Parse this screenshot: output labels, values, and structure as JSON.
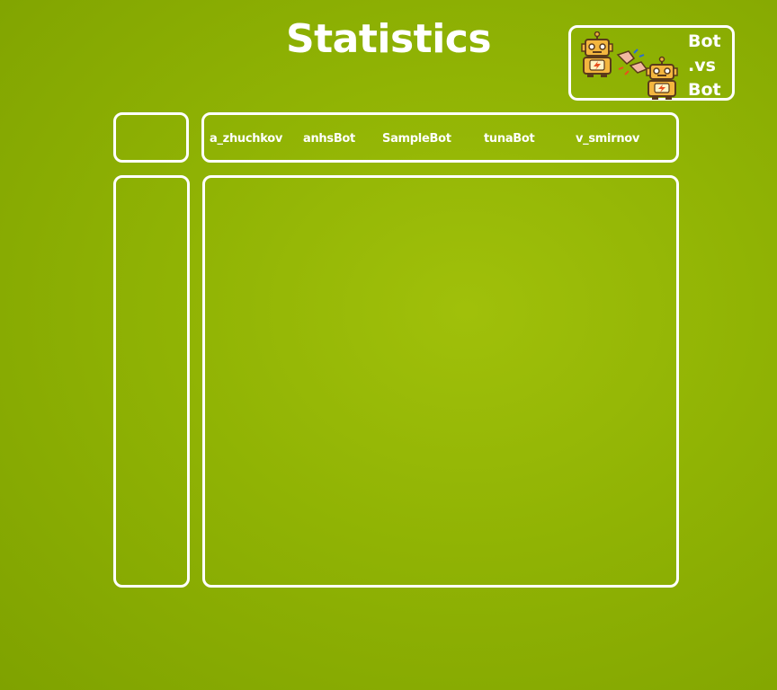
{
  "page": {
    "title": "Statistics"
  },
  "logo": {
    "lines": [
      "Bot",
      ".vs",
      "Bot"
    ],
    "icons": [
      "robot-icon",
      "fist-bump-icon",
      "robot-icon"
    ]
  },
  "table": {
    "columns": [
      "a_zhuchkov",
      "anhsBot",
      "SampleBot",
      "tunaBot",
      "v_smirnov"
    ],
    "rows": [],
    "cells": []
  },
  "colors": {
    "background": "#90b304",
    "border": "#ffffff",
    "text": "#ffffff",
    "robot_body": "#f4b63f",
    "robot_outline": "#5a3a1a"
  }
}
